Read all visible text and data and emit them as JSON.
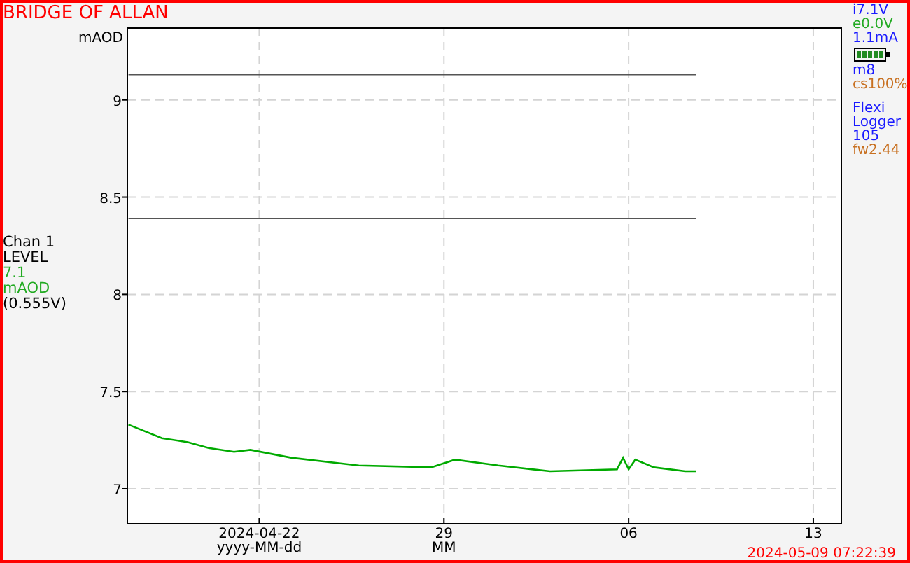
{
  "title": "BRIDGE OF ALLAN",
  "channel": {
    "type": "LEVEL",
    "reading": "7.1",
    "unit": "mAOD",
    "voltage": "(0.555V)"
  },
  "status": [
    [
      {
        "kind": "text",
        "text": "i7.1V",
        "color": "#1a1aff"
      },
      {
        "kind": "text",
        "text": "e0.0V",
        "color": "#22aa22"
      },
      {
        "kind": "text",
        "text": "1.1mA",
        "color": "#1a1aff"
      },
      {
        "kind": "battery"
      },
      {
        "kind": "text",
        "text": "m8",
        "color": "#1a1aff"
      },
      {
        "kind": "text",
        "text": "cs100%",
        "color": "#c87020"
      }
    ],
    [
      {
        "kind": "text",
        "text": "Flexi",
        "color": "#1a1aff"
      },
      {
        "kind": "text",
        "text": "Logger",
        "color": "#1a1aff"
      },
      {
        "kind": "text",
        "text": "105",
        "color": "#1a1aff"
      },
      {
        "kind": "text",
        "text": "fw2.44",
        "color": "#c87020"
      }
    ]
  ],
  "chart_data": {
    "type": "line",
    "ylabel": "mAOD",
    "x": [
      "2024-04-17T01:00",
      "2024-04-18T07:30",
      "2024-04-19T07:00",
      "2024-04-20T02:00",
      "2024-04-21T01:00",
      "2024-04-21T16:00",
      "2024-04-23T05:00",
      "2024-04-25T18:30",
      "2024-04-28T12:30",
      "2024-04-29T10:00",
      "2024-05-01T01:30",
      "2024-05-03T00:30",
      "2024-05-05T13:30",
      "2024-05-05T19:00",
      "2024-05-06T00:00",
      "2024-05-06T06:00",
      "2024-05-06T23:00",
      "2024-05-08T03:30",
      "2024-05-08T13:00"
    ],
    "series": [
      {
        "name": "Chan 1",
        "color": "#00aa00",
        "values": [
          7.33,
          7.26,
          7.24,
          7.21,
          7.19,
          7.2,
          7.16,
          7.12,
          7.11,
          7.15,
          7.12,
          7.09,
          7.1,
          7.16,
          7.1,
          7.15,
          7.11,
          7.09,
          7.09
        ]
      },
      {
        "color": "#555555",
        "values": [
          9.13,
          9.13,
          9.13,
          9.13,
          9.13,
          9.13,
          9.13,
          9.13,
          9.13,
          9.13,
          9.13,
          9.13,
          9.13,
          9.13,
          9.13,
          9.13,
          9.13,
          9.13,
          9.13
        ]
      },
      {
        "color": "#555555",
        "values": [
          8.39,
          8.39,
          8.39,
          8.39,
          8.39,
          8.39,
          8.39,
          8.39,
          8.39,
          8.39,
          8.39,
          8.39,
          8.39,
          8.39,
          8.39,
          8.39,
          8.39,
          8.39,
          8.39
        ]
      }
    ],
    "grid": true,
    "xlim": [
      "2024-04-17T00:00",
      "2024-05-14T01:30"
    ],
    "ylim": [
      6.82,
      9.37
    ],
    "xticks": [
      {
        "value": "2024-04-22",
        "label": "2024-04-22"
      },
      {
        "value": "2024-04-29",
        "label": "29"
      },
      {
        "value": "2024-05-06",
        "label": "06"
      },
      {
        "value": "2024-05-13",
        "label": "13"
      }
    ],
    "yticks": [
      7,
      7.5,
      8,
      8.5,
      9
    ]
  },
  "x_tick_formats": [
    "yyyy-MM-dd",
    "MM"
  ],
  "timestamp": "2024-05-09 07:22:39"
}
